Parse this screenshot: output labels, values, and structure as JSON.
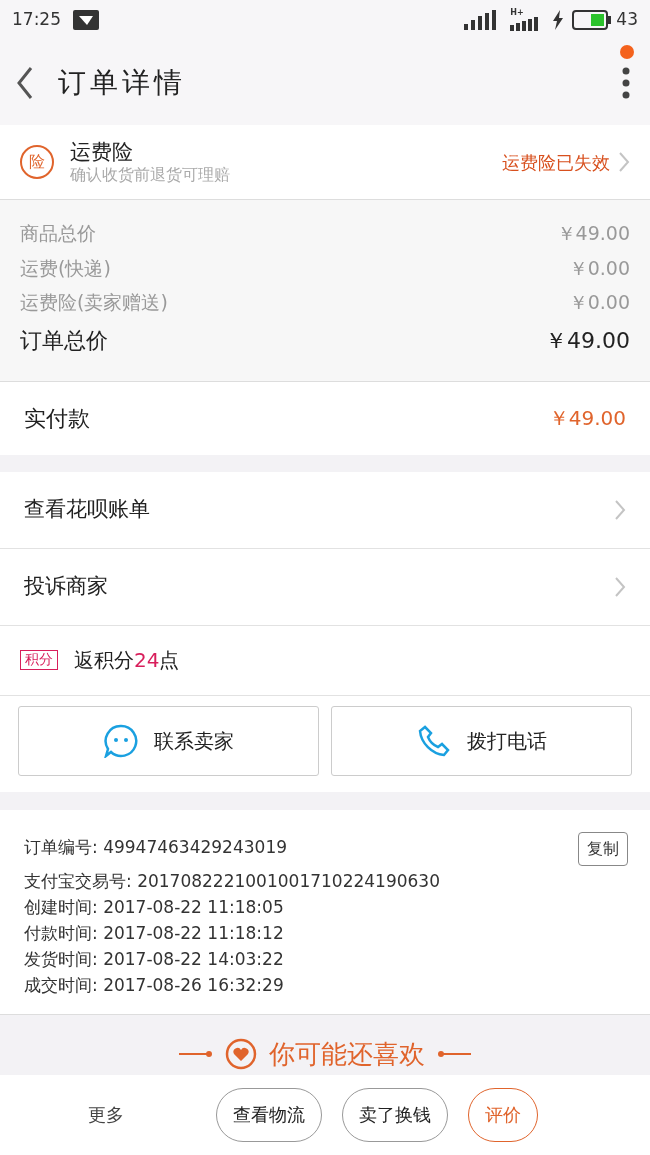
{
  "status_bar": {
    "time": "17:25",
    "network": "H+",
    "battery": "43"
  },
  "header": {
    "title": "订单详情",
    "notification": true
  },
  "insurance": {
    "badge": "险",
    "title": "运费险",
    "subtitle": "确认收货前退货可理赔",
    "status": "运费险已失效"
  },
  "prices": [
    {
      "label": "商品总价",
      "value": "￥49.00",
      "kind": "sub"
    },
    {
      "label": "运费(快递)",
      "value": "￥0.00",
      "kind": "sub"
    },
    {
      "label": "运费险(卖家赠送)",
      "value": "￥0.00",
      "kind": "sub"
    },
    {
      "label": "订单总价",
      "value": "￥49.00",
      "kind": "total"
    }
  ],
  "paid": {
    "label": "实付款",
    "value": "￥49.00"
  },
  "links": [
    {
      "label": "查看花呗账单"
    },
    {
      "label": "投诉商家"
    }
  ],
  "points": {
    "badge": "积分",
    "prefix": "返积分",
    "amount": "24",
    "suffix": "点"
  },
  "contact_buttons": [
    {
      "label": "联系卖家",
      "kind": "chat"
    },
    {
      "label": "拨打电话",
      "kind": "phone"
    }
  ],
  "order_info": {
    "copy_button": "复制",
    "rows": [
      {
        "label": "订单编号:",
        "value": "49947463429243019"
      },
      {
        "label": "支付宝交易号:",
        "value": "2017082221001001710224190630"
      },
      {
        "label": "创建时间:",
        "value": "2017-08-22 11:18:05"
      },
      {
        "label": "付款时间:",
        "value": "2017-08-22 11:18:12"
      },
      {
        "label": "发货时间:",
        "value": "2017-08-22 14:03:22"
      },
      {
        "label": "成交时间:",
        "value": "2017-08-26 16:32:29"
      }
    ]
  },
  "recommend": {
    "title": "你可能还喜欢"
  },
  "bottom_bar": {
    "more": "更多",
    "buttons": [
      {
        "label": "查看物流",
        "kind": "plain"
      },
      {
        "label": "卖了换钱",
        "kind": "plain"
      },
      {
        "label": "评价",
        "kind": "primary"
      }
    ]
  }
}
